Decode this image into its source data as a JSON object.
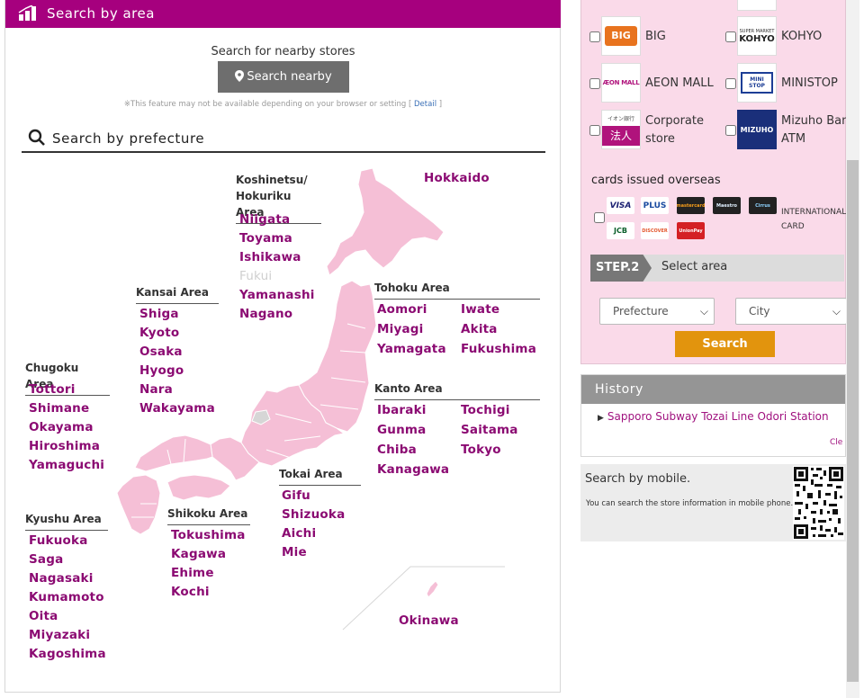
{
  "header": {
    "title": "Search by area",
    "bg_color": "#a6007e"
  },
  "nearby": {
    "caption": "Search for nearby stores",
    "button_label": "Search nearby",
    "note": "※This feature may not be available depending on your browser or setting [",
    "detail_link": "Detail",
    "note_close": "]"
  },
  "prefecture_heading": "Search by prefecture",
  "regions": {
    "koshinetsu": {
      "title_line1": "Koshinetsu/",
      "title_line2": "Hokuriku Area",
      "prefs": [
        "Niigata",
        "Toyama",
        "Ishikawa",
        "Fukui",
        "Yamanashi",
        "Nagano"
      ]
    },
    "hokkaido": {
      "prefs": [
        "Hokkaido"
      ]
    },
    "kansai": {
      "title": "Kansai Area",
      "prefs": [
        "Shiga",
        "Kyoto",
        "Osaka",
        "Hyogo",
        "Nara",
        "Wakayama"
      ]
    },
    "tohoku": {
      "title": "Tohoku Area",
      "prefs": [
        "Aomori",
        "Iwate",
        "Miyagi",
        "Akita",
        "Yamagata",
        "Fukushima"
      ]
    },
    "chugoku": {
      "title": "Chugoku Area",
      "prefs": [
        "Tottori",
        "Shimane",
        "Okayama",
        "Hiroshima",
        "Yamaguchi"
      ]
    },
    "kanto": {
      "title": "Kanto Area",
      "prefs": [
        "Ibaraki",
        "Tochigi",
        "Gunma",
        "Saitama",
        "Chiba",
        "Tokyo",
        "Kanagawa"
      ]
    },
    "tokai": {
      "title": "Tokai Area",
      "prefs": [
        "Gifu",
        "Shizuoka",
        "Aichi",
        "Mie"
      ]
    },
    "shikoku": {
      "title": "Shikoku Area",
      "prefs": [
        "Tokushima",
        "Kagawa",
        "Ehime",
        "Kochi"
      ]
    },
    "kyushu": {
      "title": "Kyushu Area",
      "prefs": [
        "Fukuoka",
        "Saga",
        "Nagasaki",
        "Kumamoto",
        "Oita",
        "Miyazaki",
        "Kagoshima"
      ]
    },
    "okinawa": {
      "prefs": [
        "Okinawa"
      ]
    }
  },
  "stores": {
    "big": {
      "name": "BIG",
      "logo_text": "BIG"
    },
    "kohyo": {
      "name": "KOHYO",
      "logo_small": "SUPER MARKET",
      "logo_text": "KOHYO"
    },
    "aeon_mall": {
      "name": "AEON MALL",
      "logo_text": "ÆON MALL"
    },
    "ministop": {
      "name": "MINISTOP",
      "logo_text": "MINI STOP"
    },
    "corporate": {
      "name_line1": "Corporate",
      "name_line2": "store",
      "logo_top": "イオン銀行",
      "logo_bottom": "法人"
    },
    "mizuho": {
      "name_line1": "Mizuho Bank",
      "name_line2": "ATM",
      "logo_text": "MIZUHO"
    }
  },
  "overseas": {
    "title": "cards issued overseas",
    "cards": [
      "VISA",
      "PLUS",
      "mastercard",
      "Maestro",
      "Cirrus",
      "JCB",
      "DISCOVER",
      "UnionPay"
    ],
    "intl_line1": "INTERNATIONAL",
    "intl_line2": "CARD"
  },
  "step2": {
    "badge": "STEP.2",
    "label": "Select area"
  },
  "selects": {
    "prefecture": "Prefecture",
    "city": "City"
  },
  "search_button": "Search",
  "history": {
    "title": "History",
    "items": [
      "Sapporo Subway Tozai Line Odori Station"
    ],
    "clear": "Cle"
  },
  "mobile": {
    "title": "Search by mobile.",
    "desc": "You can search the store information in mobile phone."
  },
  "colors": {
    "pref_link": "#8b0a72",
    "map_fill": "#f5bfd6",
    "panel_pink": "#fadae9",
    "search_orange": "#e2940d"
  }
}
